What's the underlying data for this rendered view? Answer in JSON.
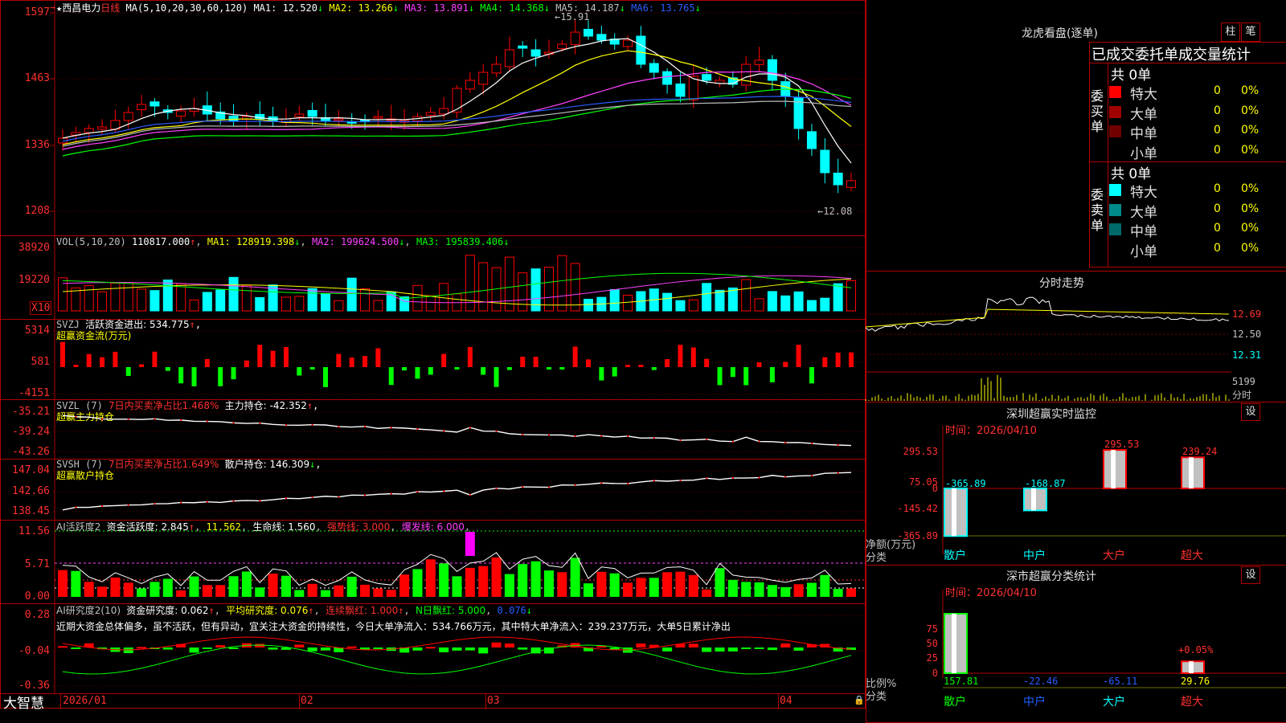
{
  "stock": {
    "star": "★",
    "name": "西昌电力",
    "period": "日线",
    "ma_params": "MA(5,10,20,30,60,120)",
    "ma": [
      {
        "label": "MA1:",
        "value": "12.520",
        "arrow": "↓",
        "color": "#ffffff"
      },
      {
        "label": "MA2:",
        "value": "13.266",
        "arrow": "↓",
        "color": "#ffff00"
      },
      {
        "label": "MA3:",
        "value": "13.891",
        "arrow": "↓",
        "color": "#ff40ff"
      },
      {
        "label": "MA4:",
        "value": "14.368",
        "arrow": "↓",
        "color": "#00ff00"
      },
      {
        "label": "MA5:",
        "value": "14.187",
        "arrow": "↓",
        "color": "#c0c0c0"
      },
      {
        "label": "MA6:",
        "value": "13.765",
        "arrow": "↓",
        "color": "#2a5cff"
      }
    ],
    "price_axis": [
      "1597",
      "1463",
      "1336",
      "1208"
    ],
    "high_label": "15.91",
    "low_label": "12.08"
  },
  "vol": {
    "title": "VOL(5,10,20)",
    "value": "110817.000",
    "arrow": "↑",
    "ma1": "MA1: 128919.398",
    "ma1_arrow": "↓",
    "ma2": "MA2: 199624.500",
    "ma2_arrow": "↓",
    "ma3": "MA3: 195839.406",
    "ma3_arrow": "↓",
    "axis": [
      "38920",
      "19220"
    ],
    "unit": "X10"
  },
  "svzj": {
    "title": "SVZJ",
    "line1": "活跃资金进出: 534.775",
    "arrow": "↑",
    "comma": ",",
    "line2": "超赢资金流(万元)",
    "axis": [
      "5314",
      "581",
      "-4151"
    ]
  },
  "svzl": {
    "title": "SVZL (7)",
    "t1": "7日内买卖净占比1.468%",
    "t2": "主力持仓: -42.352",
    "arrow": "↑",
    "comma": ",",
    "line2": "超赢主力持仓",
    "axis": [
      "-35.21",
      "-39.24",
      "-43.26"
    ]
  },
  "svsh": {
    "title": "SVSH (7)",
    "t1": "7日内买卖净占比1.649%",
    "t2": "散户持仓: 146.309",
    "arrow": "↓",
    "comma": ",",
    "line2": "超赢散户持仓",
    "axis": [
      "147.04",
      "142.66",
      "138.45"
    ]
  },
  "ai1": {
    "title": "AI活跃度2",
    "t1": "资金活跃度: 2.845",
    "a1": "↑",
    "t2": "11.562",
    "t3": "生命线: 1.560",
    "t4": "强势线: 3.000",
    "t5": "爆发线: 6.000",
    "axis": [
      "11.56",
      "5.71",
      "0.00"
    ]
  },
  "ai2": {
    "title": "AI研究度2(10)",
    "t1": "资金研究度: 0.062",
    "a1": "↑",
    "t2": "平均研究度: 0.076",
    "a2": "↑",
    "t3": "连续飘红: 1.000",
    "a3": "↑",
    "t4": "N日飘红: 5.000",
    "t5": "0.076",
    "a5": "↓",
    "comment": "近期大资金总体偏多，虽不活跃，但有异动，宜关注大资金的持续性，今日大单净流入：534.766万元，其中特大单净流入：239.237万元，大单5日累计净出",
    "axis": [
      "0.28",
      "-0.04",
      "-0.36"
    ]
  },
  "dates": [
    "2026/01",
    "02",
    "03",
    "04"
  ],
  "brand": "大智慧",
  "right": {
    "lhb_title": "龙虎看盘(逐单)",
    "btn1": "柱",
    "btn2": "笔",
    "tabs_title": "已成交委托单成交量统计",
    "buy": {
      "label": "委买单",
      "total": "共 0单",
      "rows": [
        {
          "name": "特大",
          "v": "0",
          "p": "0%",
          "color": "#ff0000"
        },
        {
          "name": "大单",
          "v": "0",
          "p": "0%",
          "color": "#a00000"
        },
        {
          "name": "中单",
          "v": "0",
          "p": "0%",
          "color": "#700000"
        },
        {
          "name": "小单",
          "v": "0",
          "p": "0%",
          "color": ""
        }
      ]
    },
    "sell": {
      "label": "委卖单",
      "total": "共 0单",
      "rows": [
        {
          "name": "特大",
          "v": "0",
          "p": "0%",
          "color": "#00ffff"
        },
        {
          "name": "大单",
          "v": "0",
          "p": "0%",
          "color": "#008a8a"
        },
        {
          "name": "中单",
          "v": "0",
          "p": "0%",
          "color": "#006a6a"
        },
        {
          "name": "小单",
          "v": "0",
          "p": "0%",
          "color": ""
        }
      ]
    },
    "intraday_title": "分时走势",
    "intraday_axis": [
      "12.69",
      "12.50",
      "12.31",
      "5199"
    ],
    "intraday_unit": "分时",
    "sz_title": "深圳超赢实时监控",
    "set1": "设",
    "sz_time": "时间：2026/04/10",
    "sz_axis": [
      "295.53",
      "75.05",
      "0",
      "-145.42",
      "-365.89"
    ],
    "sz_labels": [
      {
        "name": "散户",
        "value": "-365.89"
      },
      {
        "name": "中户",
        "value": "-168.87"
      },
      {
        "name": "大户",
        "value": "295.53"
      },
      {
        "name": "超大",
        "value": "239.24"
      }
    ],
    "sz_ylabel": "净额(万元)",
    "sz_xlabel": "分类",
    "cls_title": "深市超赢分类统计",
    "set2": "设",
    "cls_time": "时间：2026/04/10",
    "cls_axis": [
      "75",
      "50",
      "25",
      "0"
    ],
    "cls_labels": [
      {
        "name": "散户",
        "value": "157.81"
      },
      {
        "name": "中户",
        "value": "-22.46"
      },
      {
        "name": "大户",
        "value": "-65.11"
      },
      {
        "name": "超大",
        "value": "29.76"
      }
    ],
    "cls_extra": "+0.05%",
    "cls_ylabel": "比例%",
    "cls_xlabel": "分类"
  },
  "colors": {
    "up": "#ff0000",
    "down": "#00ffff",
    "border": "#b00000"
  }
}
